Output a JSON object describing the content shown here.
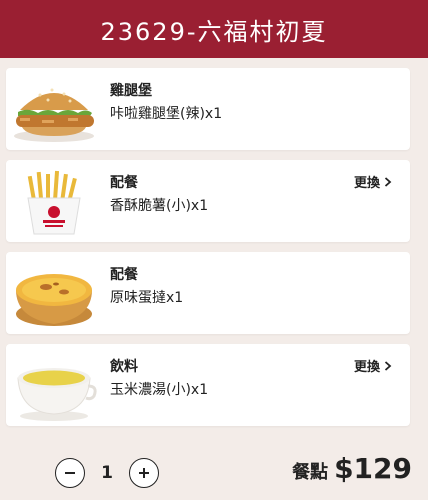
{
  "header": {
    "title": "23629-六福村初夏"
  },
  "items": [
    {
      "category": "雞腿堡",
      "name": "咔啦雞腿堡(辣)x1",
      "swap_label": "",
      "icon": "burger-image"
    },
    {
      "category": "配餐",
      "name": "香酥脆薯(小)x1",
      "swap_label": "更換",
      "icon": "fries-image"
    },
    {
      "category": "配餐",
      "name": "原味蛋撻x1",
      "swap_label": "",
      "icon": "egg-tart-image"
    },
    {
      "category": "飲料",
      "name": "玉米濃湯(小)x1",
      "swap_label": "更換",
      "icon": "corn-soup-image"
    }
  ],
  "footer": {
    "quantity": "1",
    "total_label": "餐點",
    "total_price": "$129"
  },
  "colors": {
    "header_bg": "#9a1f32",
    "page_bg": "#f3ece8"
  }
}
